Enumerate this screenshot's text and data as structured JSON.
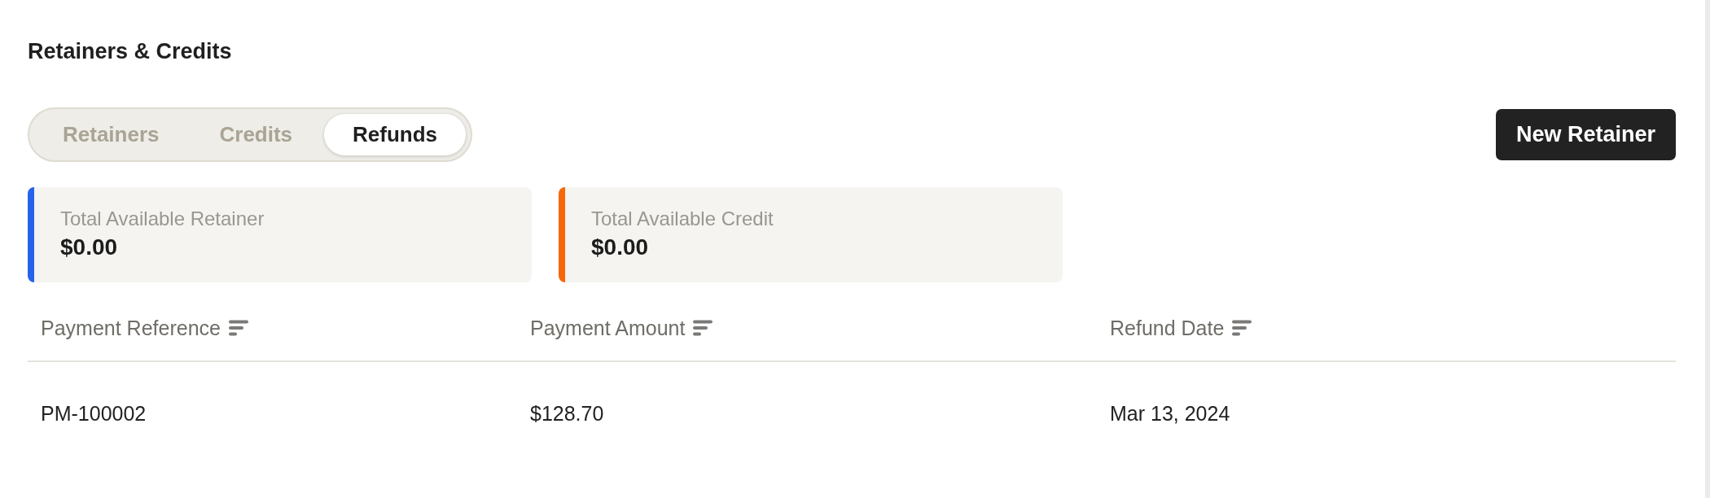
{
  "title": "Retainers & Credits",
  "tabs": [
    {
      "label": "Retainers",
      "selected": false
    },
    {
      "label": "Credits",
      "selected": false
    },
    {
      "label": "Refunds",
      "selected": true
    }
  ],
  "new_button": {
    "label": "New Retainer"
  },
  "summary_cards": [
    {
      "label": "Total Available Retainer",
      "value": "$0.00",
      "color": "#2563eb"
    },
    {
      "label": "Total Available Credit",
      "value": "$0.00",
      "color": "#f76707"
    }
  ],
  "table": {
    "columns": [
      {
        "label": "Payment Reference"
      },
      {
        "label": "Payment Amount"
      },
      {
        "label": "Refund Date"
      }
    ],
    "rows": [
      [
        "PM-100002",
        "$128.70",
        "Mar 13, 2024"
      ]
    ]
  }
}
